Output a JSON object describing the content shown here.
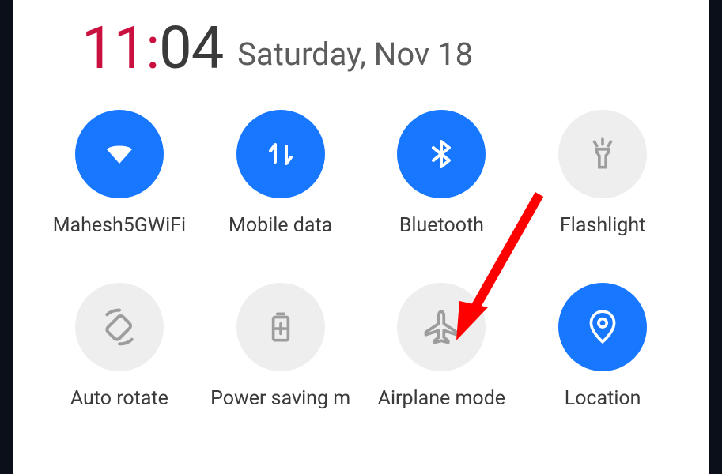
{
  "clock": {
    "hour": "11",
    "minute": "04",
    "date": "Saturday, Nov 18"
  },
  "tiles": [
    {
      "id": "wifi",
      "label": "Mahesh5GWiFi",
      "state": "active"
    },
    {
      "id": "mobile-data",
      "label": "Mobile data",
      "state": "active"
    },
    {
      "id": "bluetooth",
      "label": "Bluetooth",
      "state": "active"
    },
    {
      "id": "flashlight",
      "label": "Flashlight",
      "state": "inactive"
    },
    {
      "id": "auto-rotate",
      "label": "Auto rotate",
      "state": "inactive"
    },
    {
      "id": "power-saving",
      "label": "Power saving m",
      "state": "inactive"
    },
    {
      "id": "airplane",
      "label": "Airplane mode",
      "state": "inactive"
    },
    {
      "id": "location",
      "label": "Location",
      "state": "active"
    }
  ],
  "annotation": {
    "arrow_target": "airplane",
    "color": "#ff0000"
  }
}
